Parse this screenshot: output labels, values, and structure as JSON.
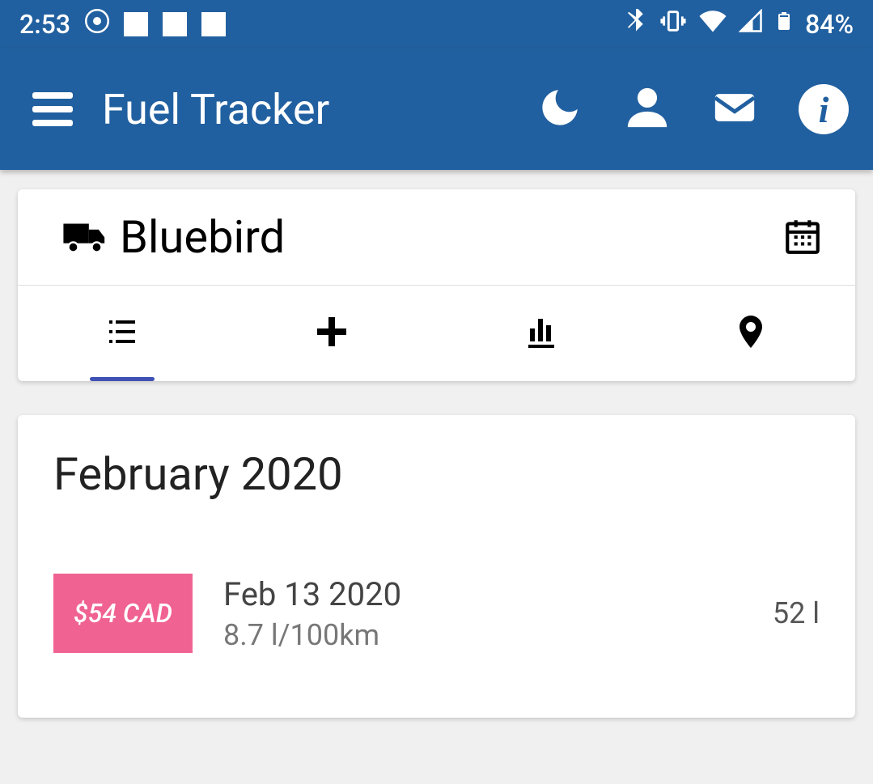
{
  "status": {
    "time": "2:53",
    "battery": "84%"
  },
  "app": {
    "title": "Fuel Tracker"
  },
  "vehicle": {
    "name": "Bluebird"
  },
  "month": {
    "title": "February 2020"
  },
  "entry": {
    "price": "$54 CAD",
    "date": "Feb 13 2020",
    "consumption": "8.7 l/100km",
    "volume": "52 l"
  }
}
